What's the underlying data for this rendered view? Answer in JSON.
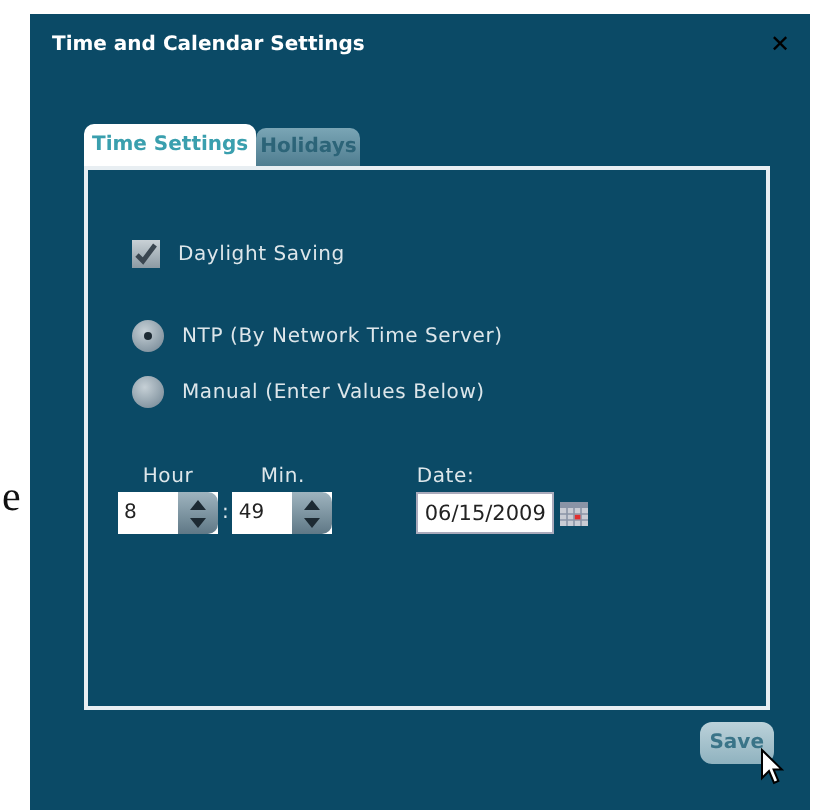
{
  "background_text": "e",
  "dialog": {
    "title": "Time and Calendar Settings",
    "close": "✕"
  },
  "tabs": [
    {
      "label": "Time Settings",
      "selected": true
    },
    {
      "label": "Holidays",
      "selected": false
    }
  ],
  "daylight_saving": {
    "label": "Daylight Saving",
    "checked": true
  },
  "time_source": [
    {
      "label": "NTP (By Network Time Server)",
      "selected": true
    },
    {
      "label": "Manual (Enter Values Below)",
      "selected": false
    }
  ],
  "hour": {
    "label": "Hour",
    "value": "8"
  },
  "separator": ":",
  "minute": {
    "label": "Min.",
    "value": "49"
  },
  "date": {
    "label": "Date:",
    "value": "06/15/2009"
  },
  "buttons": [
    "Save"
  ]
}
